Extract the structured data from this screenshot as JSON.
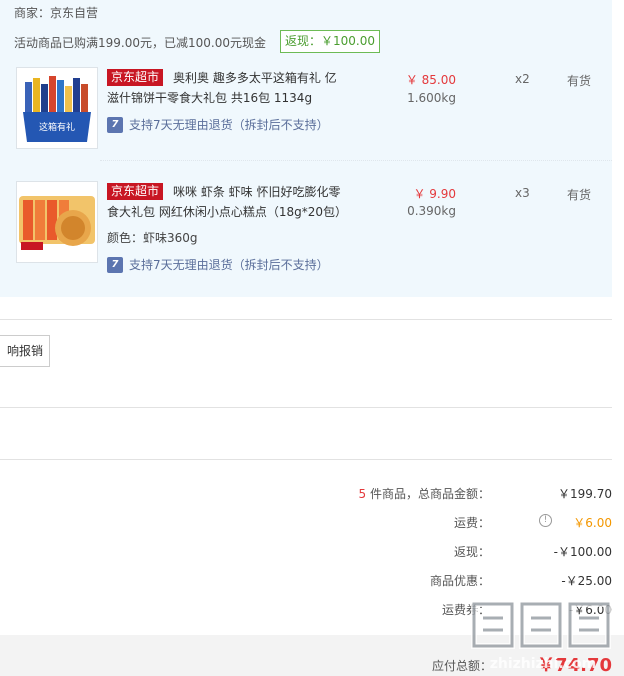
{
  "merchant": {
    "label": "商家：京东自营"
  },
  "promo": {
    "text": "活动商品已购满199.00元，已减100.00元现金",
    "rebate": "返现：￥100.00"
  },
  "products": [
    {
      "store_tag": "京东超市",
      "title": "奥利奥 趣多多太平这箱有礼 亿滋什锦饼干零食大礼包 共16包 1134g",
      "variant": "",
      "return_policy": "支持7天无理由退货（拆封后不支持）",
      "price": "￥ 85.00",
      "weight": "1.600kg",
      "qty": "x2",
      "stock": "有货"
    },
    {
      "store_tag": "京东超市",
      "title": "咪咪 虾条 虾味 怀旧好吃膨化零食大礼包 网红休闲小点心糕点（18g*20包）",
      "variant": "颜色：虾味360g",
      "return_policy": "支持7天无理由退货（拆封后不支持）",
      "price": "￥ 9.90",
      "weight": "0.390kg",
      "qty": "x3",
      "stock": "有货"
    }
  ],
  "sync_button": {
    "label": "响报销"
  },
  "summary": {
    "count": "5",
    "count_label": "件商品，总商品金额：",
    "subtotal": "￥199.70",
    "shipping_label": "运费：",
    "shipping": "￥6.00",
    "rebate_label": "返现：",
    "rebate": "-￥100.00",
    "discount_label": "商品优惠：",
    "discount": "-￥25.00",
    "shipping_coupon_label": "运费券：",
    "shipping_coupon": "-￥6.00"
  },
  "total": {
    "label": "应付总额：",
    "value": "￥74.70"
  },
  "watermark": {
    "text": "值 值 值",
    "site": "zhizhizhi.com"
  },
  "colors": {
    "accent_red": "#e4393c",
    "store_tag": "#c81623",
    "rebate_green": "#4a9d2f",
    "panel_bg": "#f0f8fd"
  },
  "icons": {
    "return": "return-7day-icon",
    "info": "info-icon"
  }
}
